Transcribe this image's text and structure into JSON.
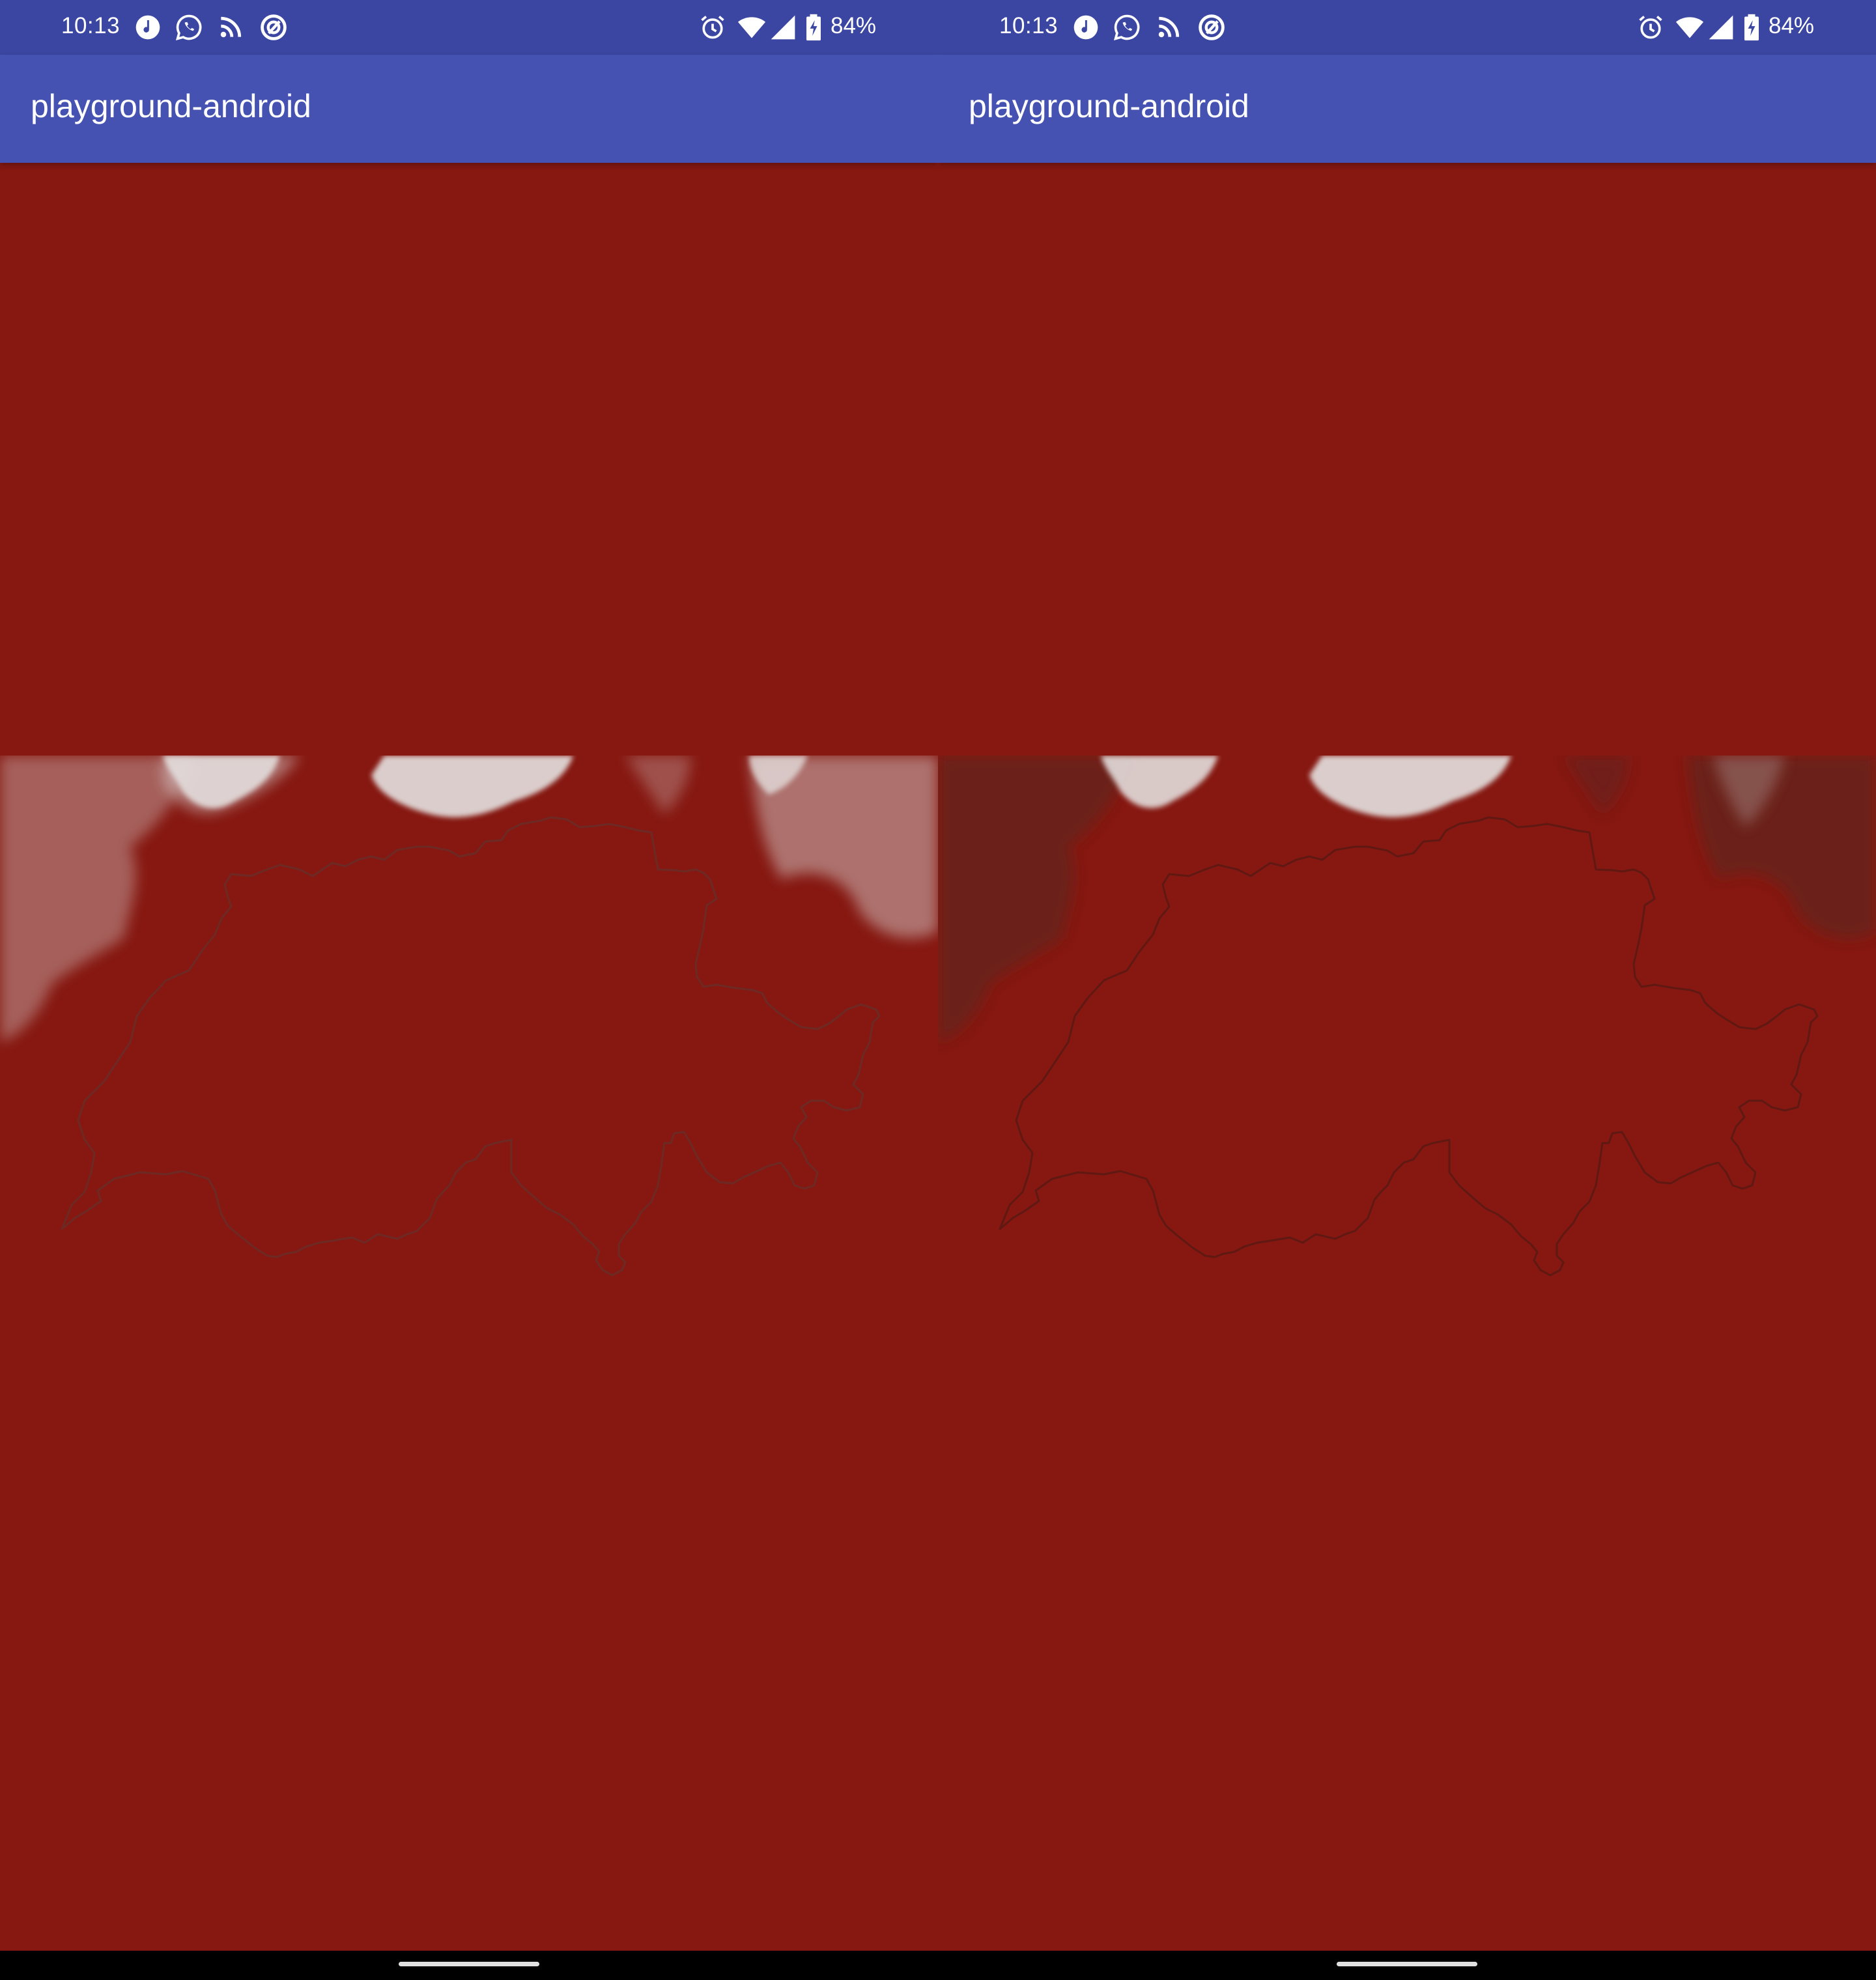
{
  "screens": [
    {
      "status": {
        "time": "10:13",
        "left_icons": [
          "music-note-icon",
          "whatsapp-icon",
          "rss-feed-icon",
          "circle-logo-icon"
        ],
        "right_icons": [
          "alarm-icon",
          "wifi-icon",
          "cell-signal-icon",
          "battery-charging-icon"
        ],
        "battery": "84%"
      },
      "appbar": {
        "title": "playground-android"
      },
      "map": {
        "overlay_state": "light-clouds"
      }
    },
    {
      "status": {
        "time": "10:13",
        "left_icons": [
          "music-note-icon",
          "whatsapp-icon",
          "rss-feed-icon",
          "circle-logo-icon"
        ],
        "right_icons": [
          "alarm-icon",
          "wifi-icon",
          "cell-signal-icon",
          "battery-charging-icon"
        ],
        "battery": "84%"
      },
      "appbar": {
        "title": "playground-android"
      },
      "map": {
        "overlay_state": "darkened-clouds"
      }
    }
  ],
  "colors": {
    "statusbar": "#3a46a1",
    "appbar": "#4552b2",
    "background": "#861811",
    "border_left": "#6d2a24",
    "border_right": "#5f1812",
    "cloud": "#d9d4d3"
  }
}
